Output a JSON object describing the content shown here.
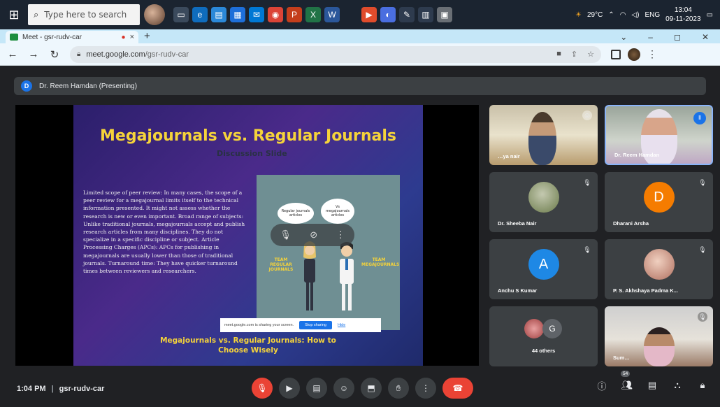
{
  "taskbar": {
    "search_placeholder": "Type here to search",
    "weather": "29°C",
    "lang": "ENG",
    "time": "13:04",
    "date": "09-11-2023"
  },
  "browser": {
    "tab_title": "Meet - gsr-rudv-car",
    "url_domain": "meet.google.com",
    "url_path": "/gsr-rudv-car"
  },
  "presenter": {
    "initial": "D",
    "label": "Dr. Reem Hamdan (Presenting)"
  },
  "slide": {
    "title": "Megajournals vs. Regular Journals",
    "subtitle": "Discussion Slide",
    "body": "Limited scope of peer review: In many cases, the scope of a peer review for a megajournal limits itself to the technical information presented. It might not assess whether the research is new or even important. Broad range of subjects: Unlike traditional journals, megajournals accept and publish research articles from many disciplines. They do not specialize in a specific discipline or subject. Article Processing Charges (APCs): APCs for publishing in megajournals are usually lower than those of traditional journals. Turnaround time: They have quicker turnaround times between reviewers and researchers.",
    "bubble_left": "Regular journals articles",
    "bubble_right": "Vs megajournals articles",
    "team_left": "TEAM REGULAR JOURNALS",
    "team_right": "TEAM MEGAJOURNALS",
    "footer": "Megajournals vs. Regular Journals: How to Choose Wisely",
    "share_text": "meet.google.com is sharing your screen.",
    "stop_label": "Stop sharing",
    "hide_label": "Hide"
  },
  "participants": [
    {
      "name": "…ya nair",
      "type": "video"
    },
    {
      "name": "Dr. Reem Hamdan",
      "type": "video"
    },
    {
      "name": "Dr. Sheeba Nair",
      "type": "photo"
    },
    {
      "name": "Dharani Arsha",
      "type": "initial",
      "initial": "D",
      "color": "#f57c00"
    },
    {
      "name": "Anchu S Kumar",
      "type": "initial",
      "initial": "A",
      "color": "#1e88e5"
    },
    {
      "name": "P. S. Akhshaya Padma K...",
      "type": "photo"
    },
    {
      "name": "44 others",
      "type": "group",
      "initial": "G"
    },
    {
      "name": "Sum…",
      "type": "video"
    }
  ],
  "bottom": {
    "time": "1:04 PM",
    "meeting_code": "gsr-rudv-car",
    "people_count": "54"
  },
  "colors": {
    "accent": "#1a73e8",
    "danger": "#ea4335",
    "slide_title": "#f5d33a"
  }
}
